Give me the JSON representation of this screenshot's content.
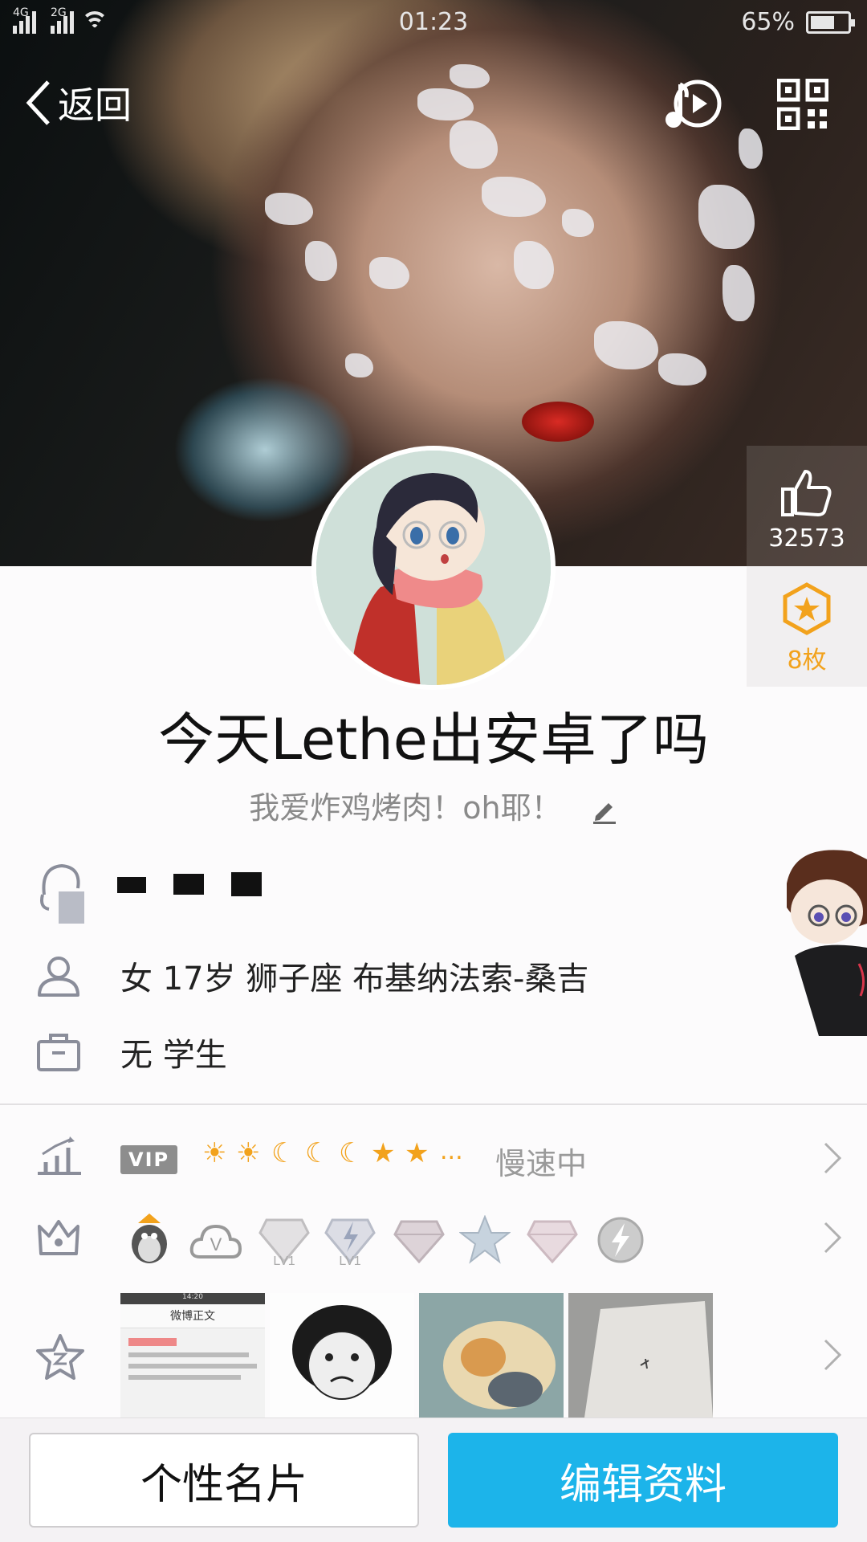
{
  "status_bar": {
    "network1": "4G",
    "network2": "2G",
    "time": "01:23",
    "battery_pct": "65%",
    "battery_level": 0.65
  },
  "nav": {
    "back_label": "返回"
  },
  "likes": {
    "count": "32573"
  },
  "badges": {
    "count": "8枚"
  },
  "profile": {
    "nickname": "今天Lethe出安卓了吗",
    "signature": "我爱炸鸡烤肉！oh耶！",
    "gender_age_sign_location": "女  17岁  狮子座  布基纳法索-桑吉",
    "occupation": "无 学生"
  },
  "vip": {
    "tag": "VIP",
    "level_icons": [
      "sun",
      "sun",
      "moon",
      "moon",
      "moon",
      "star",
      "star"
    ],
    "ellipsis": "...",
    "status": "慢速中"
  },
  "medals": {
    "items": [
      "qq-penguin-medal",
      "weiyun-medal",
      "diamond-lv1-medal",
      "diamond-lv1-bolt-medal",
      "diamond-medal",
      "star-medal",
      "diamond-pink-medal",
      "bolt-badge-medal"
    ],
    "lv_label": "LV1"
  },
  "zone": {
    "thumbnails": [
      "weibo-screenshot",
      "meme-face",
      "dog-sticker",
      "paper-note"
    ],
    "thumb1_title": "微博正文",
    "thumb1_time": "14:20"
  },
  "buttons": {
    "card": "个性名片",
    "edit": "编辑资料"
  },
  "colors": {
    "accent": "#1cb4ea",
    "badge": "#f2a21c",
    "text_gray": "#8a8a8a"
  }
}
